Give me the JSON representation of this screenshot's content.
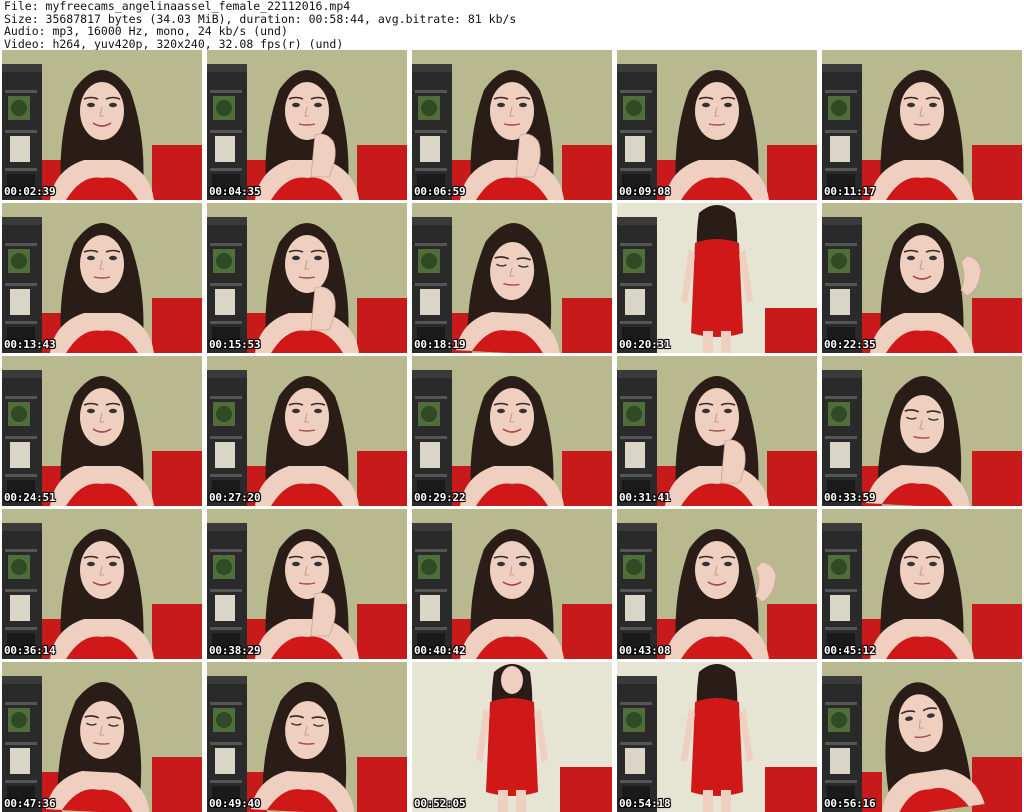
{
  "header": {
    "file_line": "File: myfreecams_angelinaassel_female_22112016.mp4",
    "size_line": "Size: 35687817 bytes (34.03 MiB), duration: 00:58:44, avg.bitrate: 81 kb/s",
    "audio_line": "Audio: mp3, 16000 Hz, mono, 24 kb/s (und)",
    "video_line": "Video: h264, yuv420p, 320x240, 32.08 fps(r) (und)"
  },
  "colors": {
    "wall": "#b9b98f",
    "dress": "#d01818",
    "sofa": "#c81a1a",
    "hair": "#2a1c16",
    "skin": "#efcfc0",
    "shelf": "#2a2a2a",
    "timestamp": "#ffffff"
  },
  "frames": [
    {
      "time": "00:02:39",
      "scene": "close",
      "pose": "smile"
    },
    {
      "time": "00:04:35",
      "scene": "close",
      "pose": "finger-lip"
    },
    {
      "time": "00:06:59",
      "scene": "close",
      "pose": "hand-chin"
    },
    {
      "time": "00:09:08",
      "scene": "close",
      "pose": "neutral"
    },
    {
      "time": "00:11:17",
      "scene": "close",
      "pose": "neutral"
    },
    {
      "time": "00:13:43",
      "scene": "close",
      "pose": "neutral"
    },
    {
      "time": "00:15:53",
      "scene": "close",
      "pose": "hand-chin"
    },
    {
      "time": "00:18:19",
      "scene": "close",
      "pose": "looking-down"
    },
    {
      "time": "00:20:31",
      "scene": "standing-back",
      "pose": "back"
    },
    {
      "time": "00:22:35",
      "scene": "close",
      "pose": "hand-hair"
    },
    {
      "time": "00:24:51",
      "scene": "close",
      "pose": "smile"
    },
    {
      "time": "00:27:20",
      "scene": "close",
      "pose": "neutral"
    },
    {
      "time": "00:29:22",
      "scene": "close",
      "pose": "smile"
    },
    {
      "time": "00:31:41",
      "scene": "close",
      "pose": "hand-chin"
    },
    {
      "time": "00:33:59",
      "scene": "close",
      "pose": "looking-down"
    },
    {
      "time": "00:36:14",
      "scene": "close",
      "pose": "smile"
    },
    {
      "time": "00:38:29",
      "scene": "close",
      "pose": "hand-chin"
    },
    {
      "time": "00:40:42",
      "scene": "close",
      "pose": "smile"
    },
    {
      "time": "00:43:08",
      "scene": "close",
      "pose": "hand-hair"
    },
    {
      "time": "00:45:12",
      "scene": "close",
      "pose": "neutral"
    },
    {
      "time": "00:47:36",
      "scene": "close",
      "pose": "looking-down"
    },
    {
      "time": "00:49:40",
      "scene": "close",
      "pose": "looking-down"
    },
    {
      "time": "00:52:05",
      "scene": "standing-front",
      "pose": "front"
    },
    {
      "time": "00:54:18",
      "scene": "standing-back",
      "pose": "back"
    },
    {
      "time": "00:56:16",
      "scene": "close",
      "pose": "tilted"
    }
  ]
}
